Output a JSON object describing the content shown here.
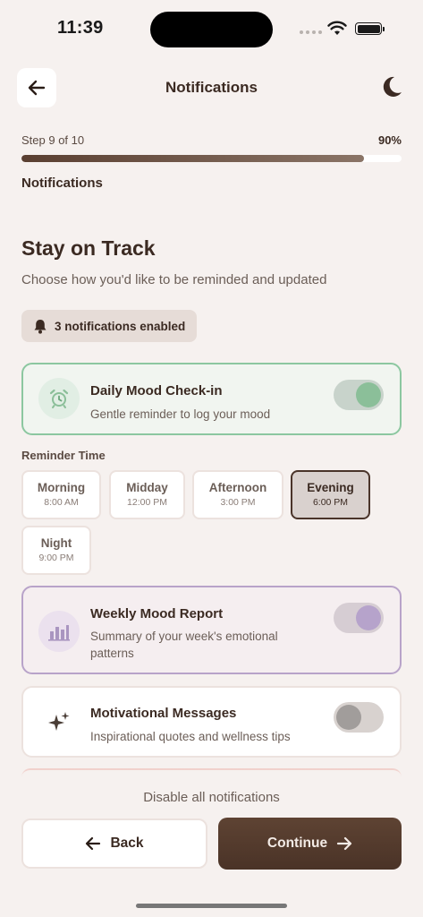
{
  "status": {
    "time": "11:39"
  },
  "header": {
    "title": "Notifications",
    "back_icon": "arrow-left-icon",
    "theme_icon": "moon-icon"
  },
  "progress": {
    "step_text": "Step 9 of 10",
    "percent_text": "90%",
    "fraction": 0.9,
    "section": "Notifications"
  },
  "intro": {
    "title": "Stay on Track",
    "subtitle": "Choose how you'd like to be reminded and updated"
  },
  "badge": {
    "icon": "bell-icon",
    "text": "3 notifications enabled"
  },
  "cards": {
    "daily": {
      "icon": "alarm-clock-icon",
      "title": "Daily Mood Check-in",
      "desc": "Gentle reminder to log your mood",
      "enabled": true
    },
    "weekly": {
      "icon": "bar-chart-icon",
      "title": "Weekly Mood Report",
      "desc": "Summary of your week's emotional patterns",
      "enabled": true
    },
    "motivational": {
      "icon": "sparkles-icon",
      "title": "Motivational Messages",
      "desc": "Inspirational quotes and wellness tips",
      "enabled": false
    }
  },
  "reminder": {
    "label": "Reminder Time",
    "options": [
      {
        "name": "Morning",
        "time": "8:00 AM"
      },
      {
        "name": "Midday",
        "time": "12:00 PM"
      },
      {
        "name": "Afternoon",
        "time": "3:00 PM"
      },
      {
        "name": "Evening",
        "time": "6:00 PM"
      },
      {
        "name": "Night",
        "time": "9:00 PM"
      }
    ],
    "selected": "Evening"
  },
  "footer": {
    "disable_all": "Disable all notifications",
    "back_label": "Back",
    "continue_label": "Continue"
  },
  "colors": {
    "accent": "#4a3327",
    "green": "#8bbf99",
    "purple": "#b6a3cb",
    "background": "#f6f1ef"
  }
}
